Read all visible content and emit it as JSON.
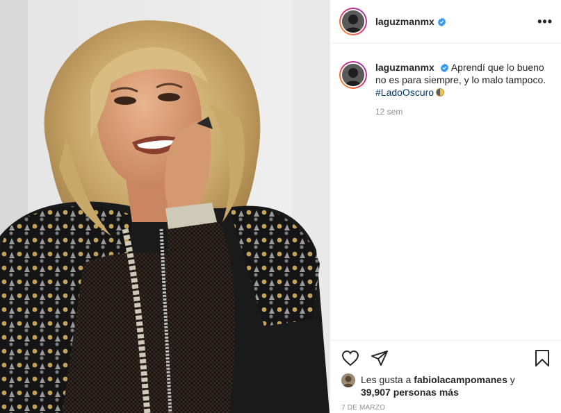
{
  "post": {
    "username": "laguzmanmx",
    "verified": true,
    "more_icon": "more-horizontal-icon",
    "caption": "Aprendí que lo bueno no es para siempre, y lo malo tampoco.",
    "hashtag": "#LadoOscuro",
    "caption_emoji": "half-moon-icon",
    "time_ago": "12 sem",
    "likes_prefix": "Les gusta a",
    "liked_by_user": "fabiolacampomanes",
    "likes_and": "y",
    "likes_count": "39,907",
    "likes_suffix": "personas más",
    "date": "7 DE MARZO"
  },
  "icons": {
    "like": "heart-icon",
    "share": "paper-plane-icon",
    "save": "bookmark-icon"
  },
  "colors": {
    "text": "#262626",
    "secondary": "#8e8e8e",
    "link": "#00376b",
    "verified": "#3897f0",
    "border": "#efefef"
  }
}
